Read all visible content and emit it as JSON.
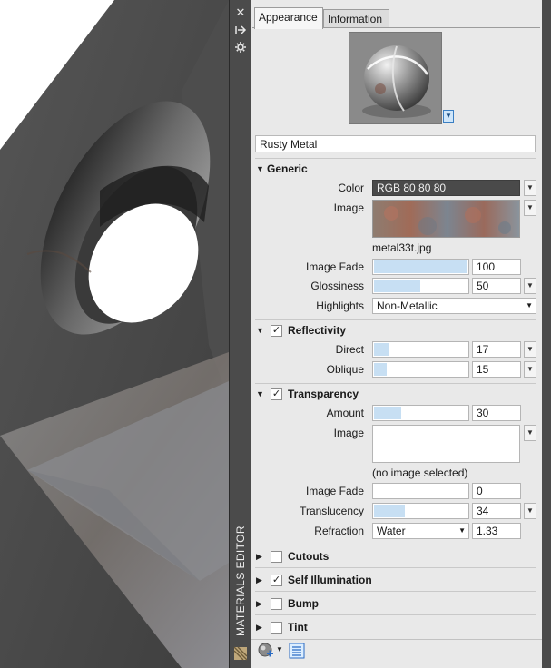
{
  "window": {
    "title": "MATERIALS EDITOR"
  },
  "palette_strip": {
    "close_icon": "close-icon",
    "autohide_icon": "autohide-icon",
    "properties_icon": "properties-icon"
  },
  "tabs": [
    {
      "label": "Appearance",
      "active": true
    },
    {
      "label": "Information",
      "active": false
    }
  ],
  "material": {
    "name": "Rusty Metal"
  },
  "generic": {
    "title": "Generic",
    "color": {
      "label": "Color",
      "value": "RGB 80 80 80"
    },
    "image": {
      "label": "Image",
      "filename": "metal33t.jpg"
    },
    "image_fade": {
      "label": "Image Fade",
      "value": "100",
      "level": 1.0
    },
    "glossiness": {
      "label": "Glossiness",
      "value": "50",
      "level": 0.5
    },
    "highlights": {
      "label": "Highlights",
      "value": "Non-Metallic"
    }
  },
  "reflectivity": {
    "title": "Reflectivity",
    "checked": true,
    "direct": {
      "label": "Direct",
      "value": "17",
      "level": 0.17
    },
    "oblique": {
      "label": "Oblique",
      "value": "15",
      "level": 0.15
    }
  },
  "transparency": {
    "title": "Transparency",
    "checked": true,
    "amount": {
      "label": "Amount",
      "value": "30",
      "level": 0.3
    },
    "image": {
      "label": "Image",
      "note": "(no image selected)"
    },
    "image_fade": {
      "label": "Image Fade",
      "value": "0",
      "level": 0.0
    },
    "translucency": {
      "label": "Translucency",
      "value": "34",
      "level": 0.34
    },
    "refraction": {
      "label": "Refraction",
      "preset": "Water",
      "value": "1.33"
    }
  },
  "collapsed_sections": [
    {
      "title": "Cutouts",
      "checked": false
    },
    {
      "title": "Self Illumination",
      "checked": true
    },
    {
      "title": "Bump",
      "checked": false
    },
    {
      "title": "Tint",
      "checked": false
    }
  ],
  "colors": {
    "strip": "#4b4b4b",
    "panel": "#e9e9e9",
    "slider_fill": "#c7dff3",
    "color_swatch": "#505050"
  }
}
